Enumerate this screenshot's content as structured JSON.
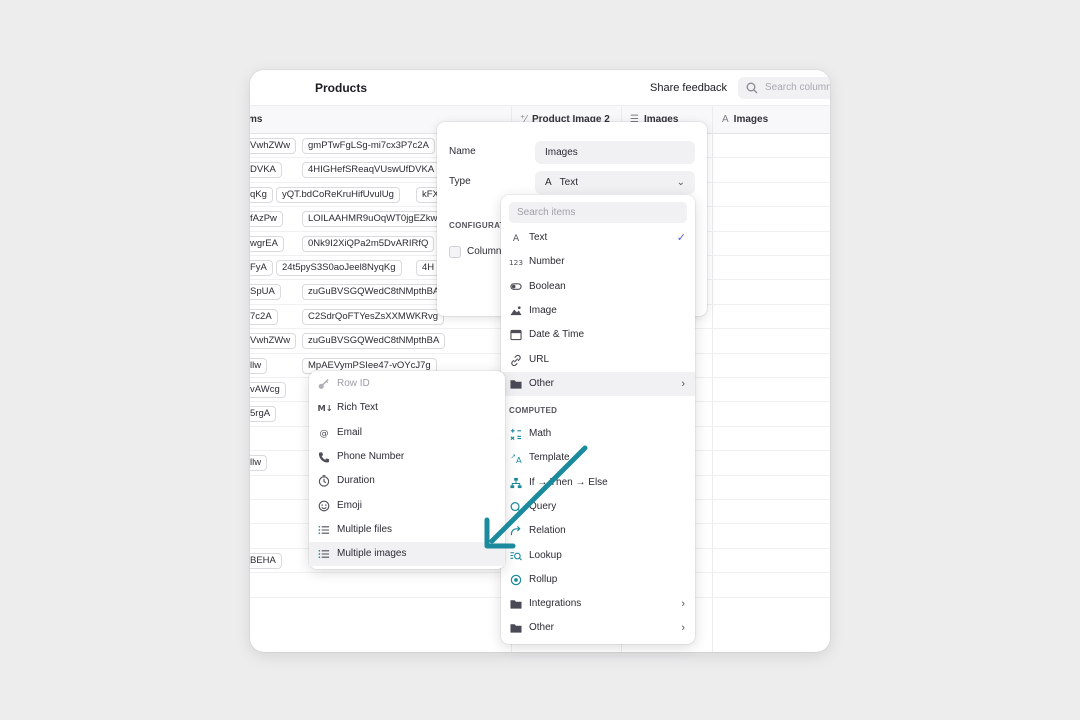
{
  "app": {
    "title": "Products",
    "share_label": "Share feedback",
    "search_placeholder": "Search columns"
  },
  "columns": {
    "first": "ms",
    "product_image": "Product Image 2",
    "images_a": "Images",
    "images_b": "Images"
  },
  "rows": [
    [
      "VwhZWw",
      "gmPTwFgLSg-mi7cx3P7c2A"
    ],
    [
      "DVKA",
      "4HIGHefSReaqVUswUfDVKA"
    ],
    [
      "qKg",
      "yQT.bdCoReKruHifUvulUg",
      "kFX"
    ],
    [
      "fAzPw",
      "LOILAAHMR9uOqWT0jgEZkw"
    ],
    [
      "wgrEA",
      "0Nk9I2XiQPa2m5DvARIRfQ"
    ],
    [
      "FyA",
      "24t5pyS3S0aoJeel8NyqKg",
      "4H"
    ],
    [
      "SpUA",
      "zuGuBVSGQWedC8tNMpthBA"
    ],
    [
      "7c2A",
      "C2SdrQoFTYesZsXXMWKRvg"
    ],
    [
      "VwhZWw",
      "zuGuBVSGQWedC8tNMpthBA"
    ],
    [
      "llw",
      "MpAEVymPSIee47-vOYcJ7g"
    ],
    [
      "vAWcg"
    ],
    [
      "5rgA"
    ],
    [],
    [
      "llw"
    ],
    [],
    [],
    [],
    [
      "BEHA"
    ],
    []
  ],
  "config_panel": {
    "name_label": "Name",
    "name_value": "Images",
    "type_label": "Type",
    "type_value": "Text",
    "config_heading": "CONFIGURATION",
    "checkbox_label": "Column"
  },
  "type_menu": {
    "search_placeholder": "Search items",
    "basic": [
      {
        "label": "Text",
        "icon": "text-icon",
        "checked": true
      },
      {
        "label": "Number",
        "icon": "number-icon"
      },
      {
        "label": "Boolean",
        "icon": "toggle-icon"
      },
      {
        "label": "Image",
        "icon": "image-icon"
      },
      {
        "label": "Date & Time",
        "icon": "calendar-icon"
      },
      {
        "label": "URL",
        "icon": "link-icon"
      },
      {
        "label": "Other",
        "icon": "folder-icon",
        "submenu": true,
        "highlighted": true
      }
    ],
    "computed_heading": "COMPUTED",
    "computed": [
      {
        "label": "Math",
        "icon": "math-icon"
      },
      {
        "label": "Template",
        "icon": "template-icon"
      },
      {
        "label": "If → Then → Else",
        "icon": "branch-icon"
      },
      {
        "label": "Query",
        "icon": "query-icon"
      },
      {
        "label": "Relation",
        "icon": "relation-icon"
      },
      {
        "label": "Lookup",
        "icon": "lookup-icon"
      },
      {
        "label": "Rollup",
        "icon": "rollup-icon"
      },
      {
        "label": "Integrations",
        "icon": "folder-icon",
        "submenu": true
      },
      {
        "label": "Other",
        "icon": "folder-icon",
        "submenu": true
      }
    ]
  },
  "other_submenu": [
    {
      "label": "Row ID",
      "icon": "key-icon",
      "disabled": true
    },
    {
      "label": "Rich Text",
      "icon": "markdown-icon"
    },
    {
      "label": "Email",
      "icon": "at-icon"
    },
    {
      "label": "Phone Number",
      "icon": "phone-icon"
    },
    {
      "label": "Duration",
      "icon": "timer-icon"
    },
    {
      "label": "Emoji",
      "icon": "emoji-icon"
    },
    {
      "label": "Multiple files",
      "icon": "list-icon"
    },
    {
      "label": "Multiple images",
      "icon": "list-icon",
      "highlighted": true
    }
  ],
  "colors": {
    "accent_check": "#5b5bd6",
    "arrow": "#1a8a9c"
  }
}
